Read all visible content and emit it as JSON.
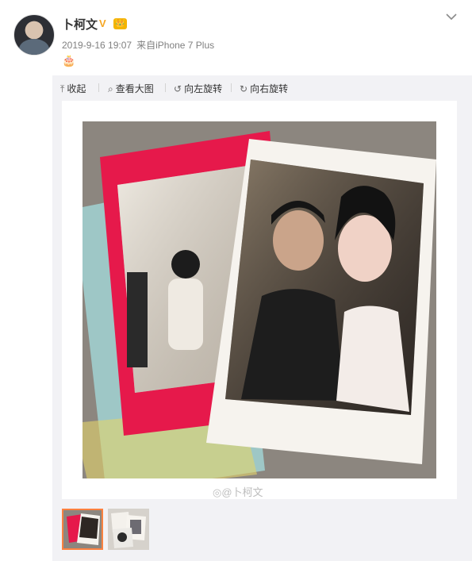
{
  "post": {
    "author": "卜柯文",
    "verified_badge": "V",
    "member_badge": "👑",
    "timestamp": "2019-9-16 19:07",
    "source_prefix": "来自",
    "source_device": "iPhone 7 Plus",
    "text": "🎂"
  },
  "toolbar": {
    "collapse_icon": "arrow-up-icon",
    "collapse_label": "收起",
    "view_large_icon": "search-icon",
    "view_large_label": "查看大图",
    "rotate_left_icon": "rotate-left-icon",
    "rotate_left_label": "向左旋转",
    "rotate_right_icon": "rotate-right-icon",
    "rotate_right_label": "向右旋转"
  },
  "image": {
    "watermark": "@卜柯文"
  },
  "thumbnails": [
    {
      "selected": true
    },
    {
      "selected": false
    }
  ],
  "colors": {
    "accent_orange": "#ff8140",
    "verified_yellow": "#f5a623",
    "muted_text": "#808080",
    "panel_bg": "#f2f2f5"
  }
}
